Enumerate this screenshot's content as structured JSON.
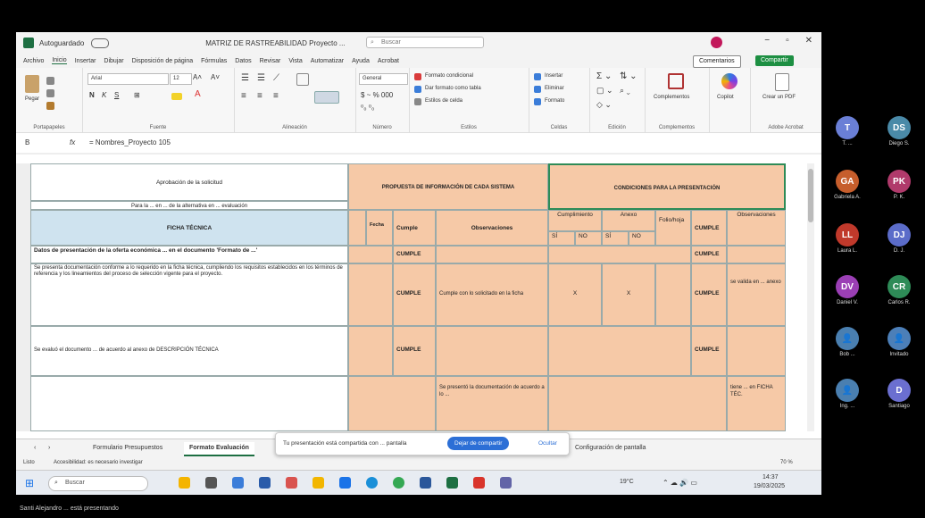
{
  "window": {
    "autosave_label": "Autoguardado",
    "file_title": "MATRIZ DE RASTREABILIDAD Proyecto ... ",
    "search_placeholder": "Buscar"
  },
  "menu": [
    "Archivo",
    "Inicio",
    "Insertar",
    "Dibujar",
    "Disposición de página",
    "Fórmulas",
    "Datos",
    "Revisar",
    "Vista",
    "Automatizar",
    "Ayuda",
    "Acrobat"
  ],
  "ribbon_buttons": {
    "comments": "Comentarios",
    "share": "Compartir"
  },
  "ribbon_groups": {
    "clipboard": {
      "label": "Portapapeles",
      "paste": "Pegar"
    },
    "font": {
      "label": "Fuente",
      "font_name": "Arial",
      "font_size": "12"
    },
    "alignment": {
      "label": "Alineación"
    },
    "number": {
      "label": "Número",
      "format": "General"
    },
    "styles": {
      "label": "Estilos",
      "items": [
        "Formato condicional",
        "Dar formato como tabla",
        "Estilos de celda"
      ]
    },
    "cells": {
      "label": "Celdas",
      "items": [
        "Insertar",
        "Eliminar",
        "Formato"
      ]
    },
    "editing": {
      "label": "Edición"
    },
    "addins": {
      "label": "Complementos",
      "item": "Complementos"
    },
    "copilot": {
      "label": "Copilot"
    },
    "pdf": {
      "label": "Adobe Acrobat",
      "item": "Crear un PDF"
    }
  },
  "formula": {
    "cell_ref": "B",
    "fx": "fx",
    "content": "= Nombres_Proyecto 105"
  },
  "sheet": {
    "header_left_title": "Aprobación de la solicitud",
    "header_left_sub": "Para la ... en ... de la alternativa en ... evaluación",
    "header_peach": "PROPUESTA DE INFORMACIÓN DE CADA SISTEMA",
    "header_green": "CONDICIONES PARA LA PRESENTACIÓN",
    "ficha_tecnica": "FICHA TÉCNICA",
    "cols": [
      "Fecha",
      "Cumple",
      "Observaciones",
      "Cumplimiento",
      "Anexo",
      "Folio/hoja",
      "CUMPLE",
      "Observaciones"
    ],
    "subcols": [
      "SÍ",
      "NO",
      "SÍ",
      "NO"
    ],
    "row1_text": "Datos de presentación de la oferta económica ... en el documento 'Formato de ...'",
    "row1_cumple": "CUMPLE",
    "row2_text": "Se presenta documentación conforme a lo requerido en la ficha técnica, cumpliendo los requisitos establecidos en los términos de referencia y los lineamientos del proceso de selección vigente para el proyecto.",
    "row2_cumple": "CUMPLE",
    "row2_obs": "Cumple con lo solicitado en la ficha",
    "row2_mark": "X",
    "row2_side": "se valida en ... anexo",
    "row3_text": "Se evaluó el documento ... de acuerdo al anexo de DESCRIPCIÓN TÉCNICA",
    "row3_cumple": "CUMPLE",
    "row4_obs": "Se presentó la documentación de acuerdo a lo ...",
    "row4_side": "tiene ... en FICHA TÉC."
  },
  "share_banner": {
    "text": "Tu presentación está compartida con ... pantalla",
    "stop": "Dejar de compartir",
    "hide": "Ocultar"
  },
  "sheet_tabs": [
    "Formulario Presupuestos",
    "Formato Evaluación"
  ],
  "status": {
    "ready": "Listo",
    "accessibility": "Accesibilidad: es necesario investigar",
    "display": "Configuración de pantalla",
    "zoom": "70 %"
  },
  "taskbar": {
    "search": "Buscar",
    "temp": "19°C",
    "time": "14:37",
    "date": "19/03/2025"
  },
  "participants": [
    {
      "initials": "T",
      "name": "T. ...",
      "color": "#6a7fd6"
    },
    {
      "initials": "DS",
      "name": "Diego S.",
      "color": "#4a8aa8"
    },
    {
      "initials": "GA",
      "name": "Gabriela A.",
      "color": "#c65e2c"
    },
    {
      "initials": "PK",
      "name": "P. K.",
      "color": "#b03a6b"
    },
    {
      "initials": "LL",
      "name": "Laura L.",
      "color": "#c0392b"
    },
    {
      "initials": "DJ",
      "name": "D. J.",
      "color": "#5b6cc9"
    },
    {
      "initials": "DV",
      "name": "Daniel V.",
      "color": "#9b3fb5"
    },
    {
      "initials": "CR",
      "name": "Carlos R.",
      "color": "#2e8b57"
    },
    {
      "initials": "",
      "name": "Bob ...",
      "color": "#4a7fb0"
    },
    {
      "initials": "",
      "name": "Invitado",
      "color": "#4c7fb8"
    },
    {
      "initials": "",
      "name": "Ing. ...",
      "color": "#4a7fb0"
    },
    {
      "initials": "D",
      "name": "Santiago",
      "color": "#6b6fd0"
    }
  ],
  "footer_text": "Santi Alejandro ... está presentando"
}
